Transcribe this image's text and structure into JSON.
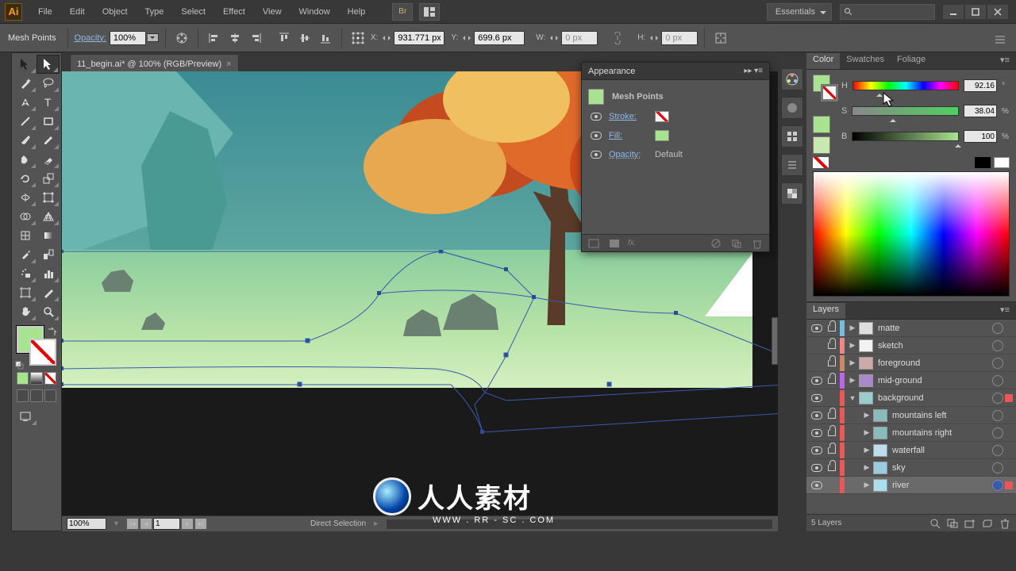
{
  "app": {
    "initials": "Ai"
  },
  "menu": [
    "File",
    "Edit",
    "Object",
    "Type",
    "Select",
    "Effect",
    "View",
    "Window",
    "Help"
  ],
  "workspace": "Essentials",
  "options": {
    "selection_label": "Mesh Points",
    "opacity_label": "Opacity:",
    "opacity_value": "100%",
    "x_label": "X:",
    "x_value": "931.771 px",
    "y_label": "Y:",
    "y_value": "699.6 px",
    "w_label": "W:",
    "w_value": "0 px",
    "h_label": "H:",
    "h_value": "0 px"
  },
  "tab": {
    "title": "11_begin.ai* @ 100% (RGB/Preview)"
  },
  "appearance": {
    "title": "Appearance",
    "object": "Mesh Points",
    "stroke_label": "Stroke:",
    "fill_label": "Fill:",
    "opacity_label": "Opacity:",
    "opacity_value": "Default"
  },
  "color": {
    "tabs": [
      "Color",
      "Swatches",
      "Foliage"
    ],
    "h_label": "H",
    "h_value": "92.16",
    "h_unit": "°",
    "s_label": "S",
    "s_value": "38.04",
    "s_unit": "%",
    "b_label": "B",
    "b_value": "100",
    "b_unit": "%"
  },
  "layers": {
    "tab": "Layers",
    "items": [
      {
        "name": "matte",
        "indent": 0,
        "color": "#7bd",
        "visible": true,
        "locked": true,
        "expandable": true,
        "open": false,
        "thumb": "#dedede"
      },
      {
        "name": "sketch",
        "indent": 0,
        "color": "#e88",
        "visible": false,
        "locked": true,
        "expandable": true,
        "open": false,
        "thumb": "#f2f2f2"
      },
      {
        "name": "foreground",
        "indent": 0,
        "color": "#c86",
        "visible": false,
        "locked": true,
        "expandable": true,
        "open": false,
        "thumb": "#caa"
      },
      {
        "name": "mid-ground",
        "indent": 0,
        "color": "#b6e",
        "visible": true,
        "locked": true,
        "expandable": true,
        "open": false,
        "thumb": "#a8c"
      },
      {
        "name": "background",
        "indent": 0,
        "color": "#e55",
        "visible": true,
        "locked": false,
        "expandable": true,
        "open": true,
        "thumb": "#9cc",
        "selected_layer": true
      },
      {
        "name": "mountains left",
        "indent": 1,
        "color": "#e55",
        "visible": true,
        "locked": true,
        "expandable": true,
        "open": false,
        "thumb": "#8bb"
      },
      {
        "name": "mountains right",
        "indent": 1,
        "color": "#e55",
        "visible": true,
        "locked": true,
        "expandable": true,
        "open": false,
        "thumb": "#8bb"
      },
      {
        "name": "waterfall",
        "indent": 1,
        "color": "#e55",
        "visible": true,
        "locked": true,
        "expandable": true,
        "open": false,
        "thumb": "#bde"
      },
      {
        "name": "sky",
        "indent": 1,
        "color": "#e55",
        "visible": true,
        "locked": true,
        "expandable": true,
        "open": false,
        "thumb": "#9cd"
      },
      {
        "name": "river",
        "indent": 1,
        "color": "#e55",
        "visible": true,
        "locked": false,
        "expandable": true,
        "open": false,
        "thumb": "#ade",
        "selected_item": true
      }
    ],
    "footer": "5 Layers"
  },
  "status": {
    "zoom": "100%",
    "page": "1",
    "tool": "Direct Selection"
  },
  "watermark": {
    "text": "人人素材",
    "url": "WWW . RR - SC . COM"
  }
}
